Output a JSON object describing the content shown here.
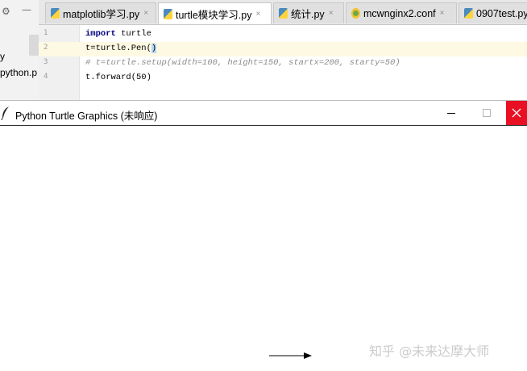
{
  "ide": {
    "project_files": [
      "y",
      "python.p"
    ],
    "tabs": [
      {
        "label": "matplotlib学习.py",
        "type": "python",
        "active": false
      },
      {
        "label": "turtle模块学习.py",
        "type": "python",
        "active": true
      },
      {
        "label": "统计.py",
        "type": "python",
        "active": false
      },
      {
        "label": "mcwnginx2.conf",
        "type": "conf",
        "active": false
      },
      {
        "label": "0907test.py",
        "type": "python",
        "active": false
      }
    ],
    "close_glyph": "×",
    "lines": [
      {
        "number": "1",
        "keyword": "import",
        "rest": " turtle"
      },
      {
        "number": "2",
        "before": "t=turtle.Pen(",
        "paren": ")",
        "current": true
      },
      {
        "number": "3",
        "comment": "# t=turtle.setup(width=100, height=150, startx=200, starty=50)"
      },
      {
        "number": "4",
        "text": "t.forward(50)"
      }
    ]
  },
  "turtle_window": {
    "title": "Python Turtle Graphics (未响应)",
    "icon": "feather-icon",
    "controls": {
      "minimize": "minimize-icon",
      "maximize": "maximize-icon",
      "close": "close-icon"
    },
    "close_color": "#e81123"
  },
  "watermark": "知乎 @未来达摩大师",
  "colors": {
    "accent_selection": "#b8d7f5",
    "keyword": "#000080",
    "current_line": "#fdf9e3"
  }
}
